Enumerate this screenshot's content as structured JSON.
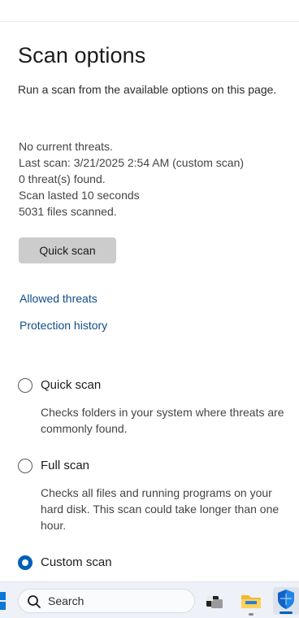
{
  "page": {
    "title": "Scan options",
    "subtitle": "Run a scan from the available options on this page."
  },
  "status": {
    "threats": "No current threats.",
    "last_scan": "Last scan: 3/21/2025 2:54 AM (custom scan)",
    "found": "0 threat(s) found.",
    "duration": "Scan lasted 10 seconds",
    "files": "5031 files scanned."
  },
  "actions": {
    "quick_scan_button": "Quick scan"
  },
  "links": {
    "allowed_threats": "Allowed threats",
    "protection_history": "Protection history"
  },
  "scan_options": [
    {
      "label": "Quick scan",
      "description": "Checks folders in your system where threats are commonly found.",
      "selected": false
    },
    {
      "label": "Full scan",
      "description": "Checks all files and running programs on your hard disk. This scan could take longer than one hour.",
      "selected": false
    },
    {
      "label": "Custom scan",
      "description": "",
      "selected": true
    }
  ],
  "taskbar": {
    "search_placeholder": "Search",
    "apps": [
      "start-icon",
      "task-view-icon",
      "file-explorer-icon",
      "windows-security-icon"
    ]
  },
  "colors": {
    "accent": "#005fb8",
    "link": "#0f4d8a",
    "button_bg": "#cccccc"
  }
}
